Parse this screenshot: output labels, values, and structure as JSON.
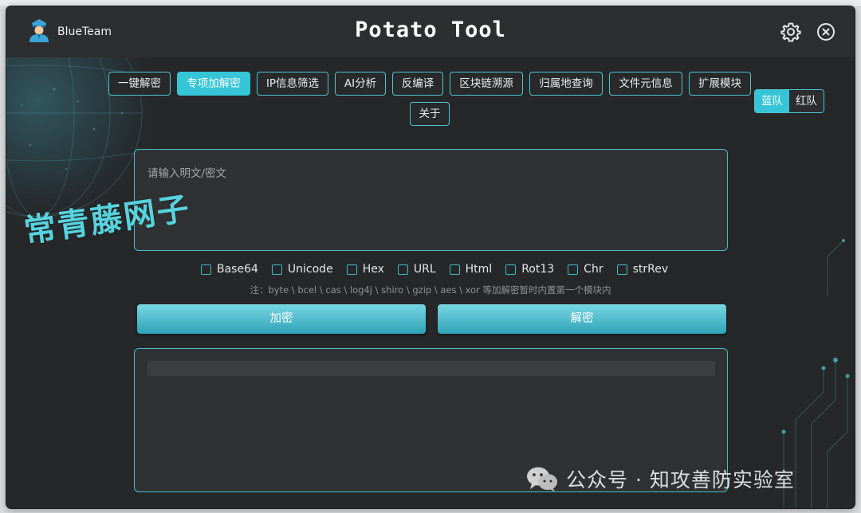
{
  "window": {
    "app_title": "Potato Tool",
    "user_name": "BlueTeam"
  },
  "tabs": [
    {
      "label": "一键解密",
      "active": false
    },
    {
      "label": "专项加解密",
      "active": true
    },
    {
      "label": "IP信息筛选",
      "active": false
    },
    {
      "label": "AI分析",
      "active": false
    },
    {
      "label": "反编译",
      "active": false
    },
    {
      "label": "区块链溯源",
      "active": false
    },
    {
      "label": "归属地查询",
      "active": false
    },
    {
      "label": "文件元信息",
      "active": false
    },
    {
      "label": "扩展模块",
      "active": false
    },
    {
      "label": "关于",
      "active": false
    }
  ],
  "team_toggle": {
    "blue_label": "蓝队",
    "red_label": "红队",
    "selected": "蓝队"
  },
  "input": {
    "placeholder": "请输入明文/密文",
    "value": ""
  },
  "overlay_text": "常青藤网子",
  "options": [
    {
      "label": "Base64",
      "checked": false
    },
    {
      "label": "Unicode",
      "checked": false
    },
    {
      "label": "Hex",
      "checked": false
    },
    {
      "label": "URL",
      "checked": false
    },
    {
      "label": "Html",
      "checked": false
    },
    {
      "label": "Rot13",
      "checked": false
    },
    {
      "label": "Chr",
      "checked": false
    },
    {
      "label": "strRev",
      "checked": false
    }
  ],
  "note": "注：byte \\ bcel \\ cas \\ log4j \\ shiro \\ gzip \\ aes \\ xor 等加解密暂时内置第一个模块内",
  "buttons": {
    "encrypt_label": "加密",
    "decrypt_label": "解密"
  },
  "output": {
    "value": ""
  },
  "brand": {
    "text": "公众号 · 知攻善防实验室"
  },
  "colors": {
    "accent": "#35c5d6",
    "window_bg": "#2b2d30",
    "field_bg": "#303133",
    "button_top": "#78d6e2",
    "button_bottom": "#2fa3b8"
  },
  "icons": {
    "user": "police-user-icon",
    "settings": "gear-icon",
    "close": "close-circle-icon",
    "brand": "wechat-icon"
  }
}
